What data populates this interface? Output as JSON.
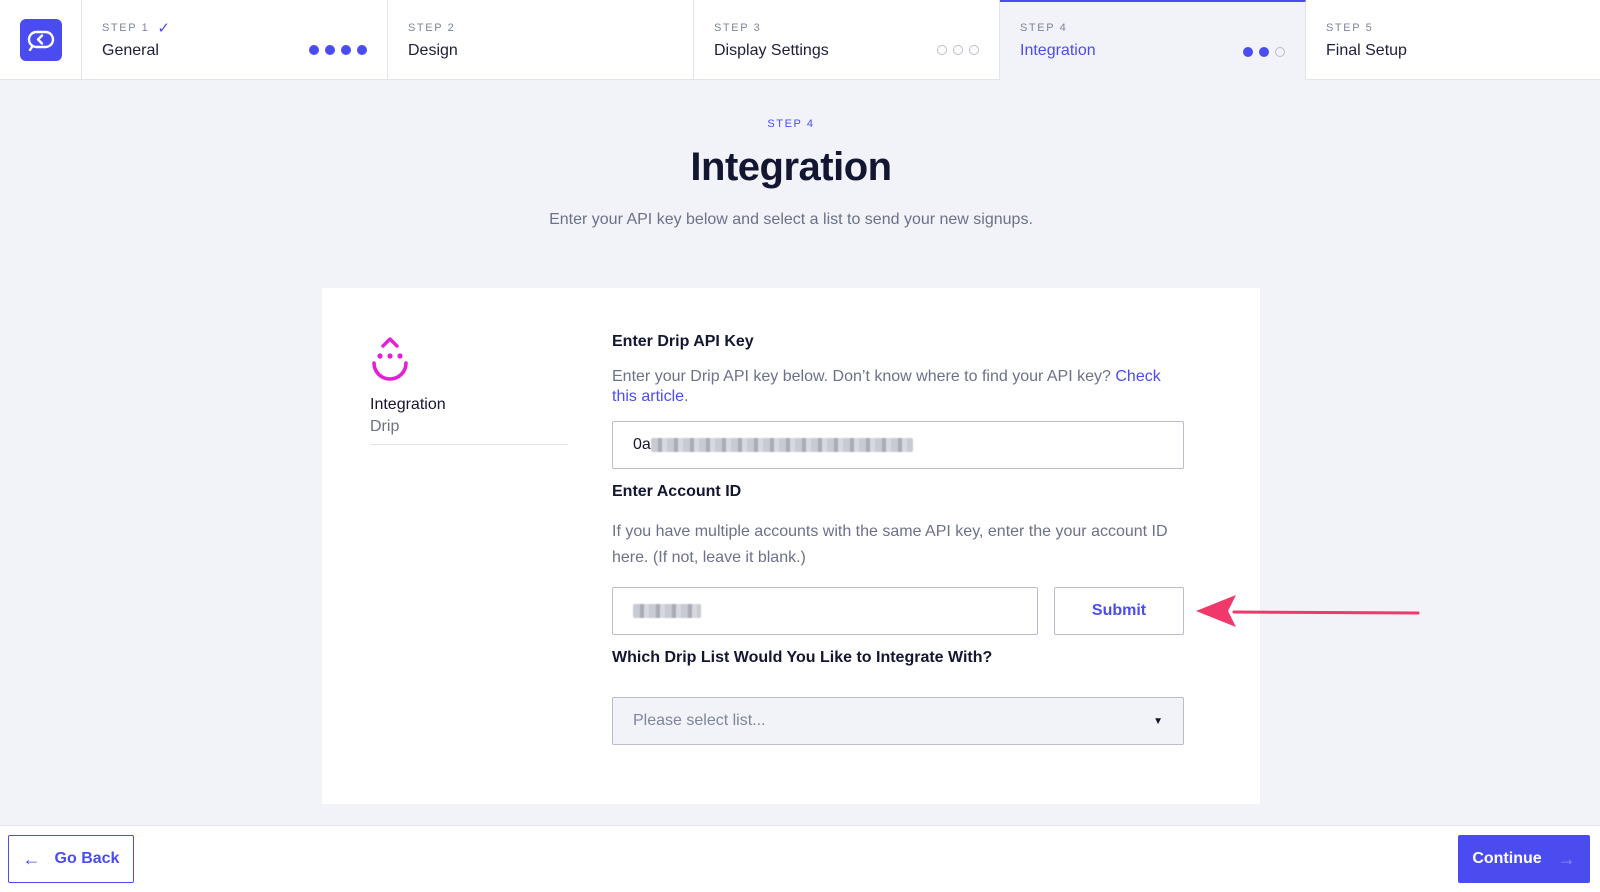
{
  "steps": [
    {
      "label": "STEP 1",
      "check": "✓",
      "name": "General",
      "dots_filled": 4,
      "dots_total": 4
    },
    {
      "label": "STEP 2",
      "name": "Design"
    },
    {
      "label": "STEP 3",
      "name": "Display Settings",
      "dots_filled": 0,
      "dots_total": 3
    },
    {
      "label": "STEP 4",
      "name": "Integration",
      "dots_filled": 2,
      "dots_total": 3,
      "active": true
    },
    {
      "label": "STEP 5",
      "name": "Final Setup"
    }
  ],
  "header": {
    "eyebrow": "STEP 4",
    "title": "Integration",
    "subtitle": "Enter your API key below and select a list to send your new signups."
  },
  "sidebar": {
    "icon": "drip-logo-icon",
    "title": "Integration",
    "subtitle": "Drip"
  },
  "form": {
    "api_key_label": "Enter Drip API Key",
    "api_key_help": "Enter your Drip API key below. Don’t know where to find your API key?",
    "api_key_help_link": "Check this article",
    "api_key_help_end": ".",
    "api_key_value_prefix": "0a",
    "account_label": "Enter Account ID",
    "account_help": "If you have multiple accounts with the same API key, enter the your account ID here. (If not, leave it blank.)",
    "submit_label": "Submit",
    "list_label": "Which Drip List Would You Like to Integrate With?",
    "list_placeholder": "Please select list..."
  },
  "footer": {
    "back_label": "Go Back",
    "back_icon": "←",
    "continue_label": "Continue",
    "continue_icon": "→"
  },
  "colors": {
    "accent": "#4b4cf0",
    "drip_brand": "#e61fd6",
    "annotation": "#f0386b"
  }
}
